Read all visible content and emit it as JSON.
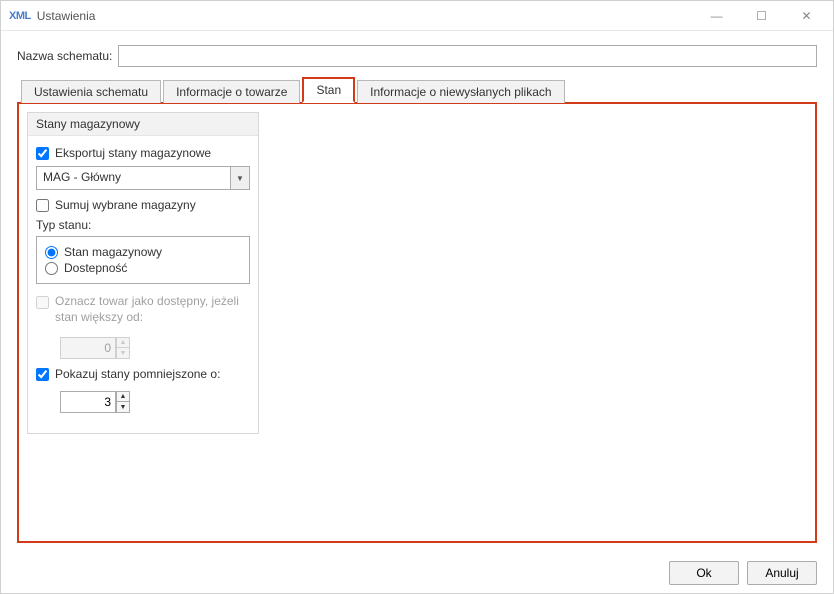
{
  "window": {
    "icon_text": "XML",
    "title": "Ustawienia",
    "min": "—",
    "max": "☐",
    "close": "✕"
  },
  "schema": {
    "label": "Nazwa schematu:",
    "value": ""
  },
  "tabs": {
    "t0": "Ustawienia schematu",
    "t1": "Informacje o towarze",
    "t2": "Stan",
    "t3": "Informacje o niewysłanych plikach"
  },
  "group": {
    "title": "Stany magazynowy",
    "export_label": "Eksportuj stany magazynowe",
    "combo_value": "MAG - Główny",
    "sum_label": "Sumuj wybrane magazyny",
    "type_label": "Typ stanu:",
    "radio1": "Stan magazynowy",
    "radio2": "Dostepność",
    "avail_label": "Oznacz towar jako dostępny, jeżeli stan większy od:",
    "avail_value": "0",
    "reduce_label": "Pokazuj stany pomniejszone o:",
    "reduce_value": "3"
  },
  "buttons": {
    "ok": "Ok",
    "cancel": "Anuluj"
  },
  "glyphs": {
    "down": "▼",
    "up": "▲"
  }
}
